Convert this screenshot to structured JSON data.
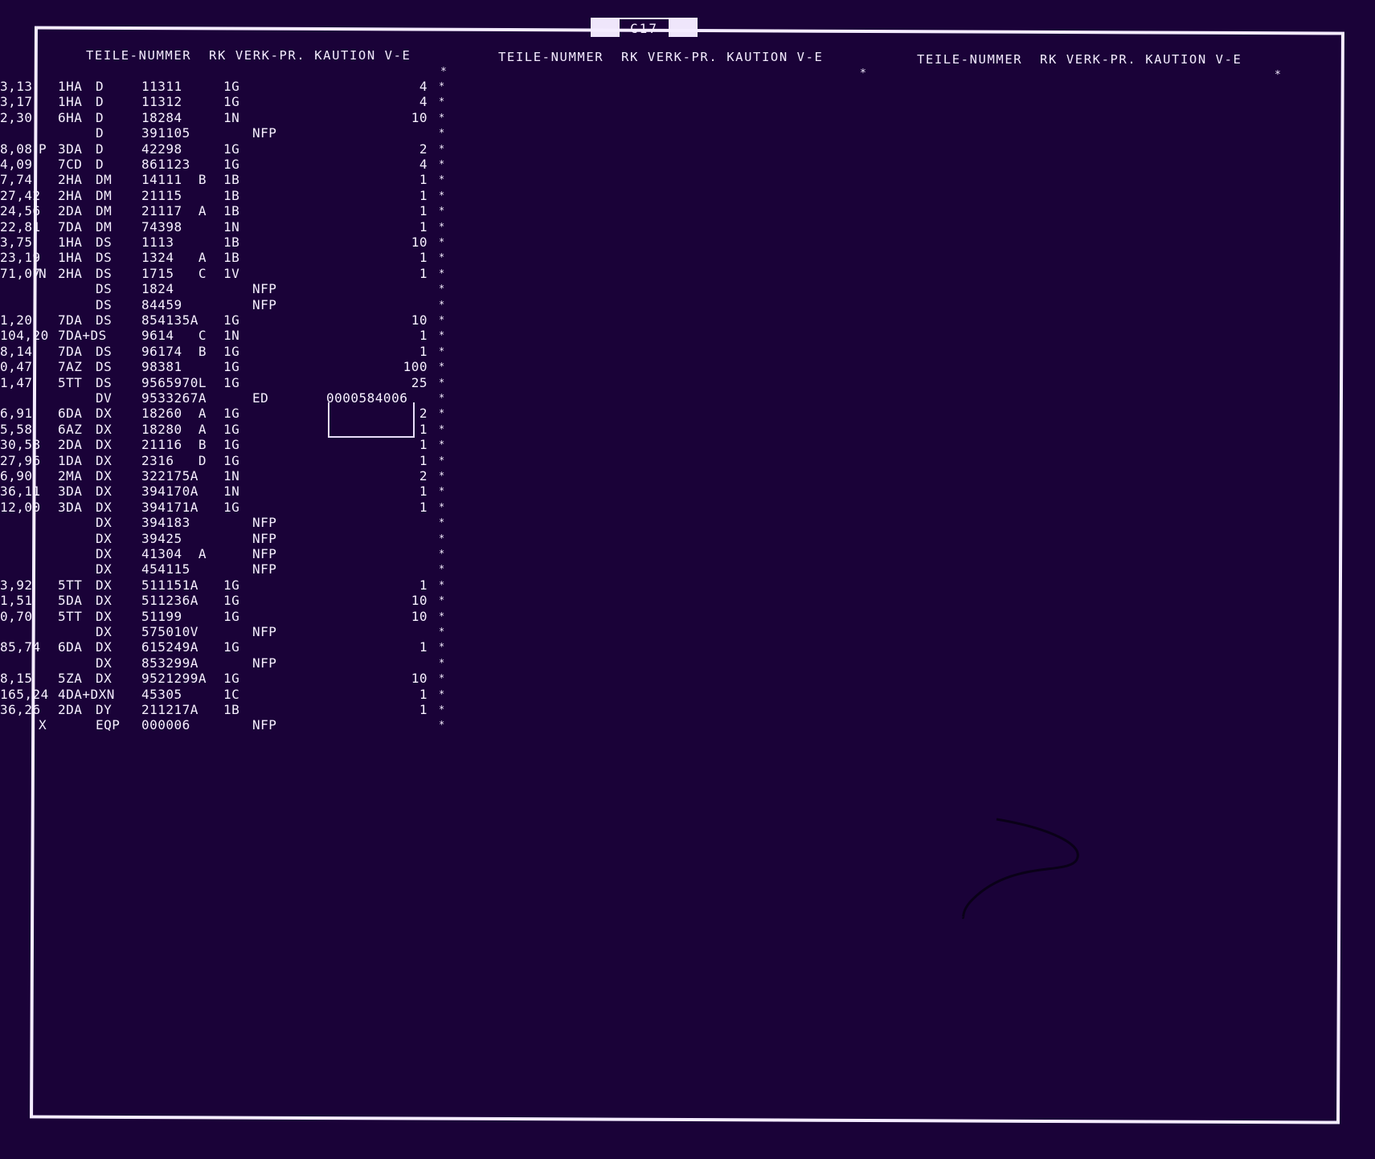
{
  "tab_label": "C17",
  "headers": [
    "TEILE-NUMMER  RK VERK-PR. KAUTION V-E",
    "TEILE-NUMMER  RK VERK-PR. KAUTION V-E",
    "TEILE-NUMMER  RK VERK-PR. KAUTION V-E"
  ],
  "header_stars": [
    "*",
    "*",
    "*"
  ],
  "rows": [
    {
      "flag": "",
      "loc": "1HA",
      "grp": "D",
      "num": "11311",
      "rk": "1G",
      "price": "3,13",
      "kaution": "",
      "ve": "4",
      "star": "*"
    },
    {
      "flag": "",
      "loc": "1HA",
      "grp": "D",
      "num": "11312",
      "rk": "1G",
      "price": "3,17",
      "kaution": "",
      "ve": "4",
      "star": "*"
    },
    {
      "flag": "",
      "loc": "6HA",
      "grp": "D",
      "num": "18284",
      "rk": "1N",
      "price": "2,30",
      "kaution": "",
      "ve": "10",
      "star": "*"
    },
    {
      "flag": "",
      "loc": "",
      "grp": "D",
      "num": "391105",
      "rk": "",
      "price": "NFP",
      "kaution": "",
      "ve": "",
      "star": "*"
    },
    {
      "flag": "P",
      "loc": "3DA",
      "grp": "D",
      "num": "42298",
      "rk": "1G",
      "price": "8,08",
      "kaution": "",
      "ve": "2",
      "star": "*"
    },
    {
      "flag": "",
      "loc": "7CD",
      "grp": "D",
      "num": "861123",
      "rk": "1G",
      "price": "4,09",
      "kaution": "",
      "ve": "4",
      "star": "*"
    },
    {
      "flag": "",
      "loc": "2HA",
      "grp": "DM",
      "num": "14111  B",
      "rk": "1B",
      "price": "7,74",
      "kaution": "",
      "ve": "1",
      "star": "*"
    },
    {
      "flag": "",
      "loc": "2HA",
      "grp": "DM",
      "num": "21115",
      "rk": "1B",
      "price": "27,42",
      "kaution": "",
      "ve": "1",
      "star": "*"
    },
    {
      "flag": "",
      "loc": "2DA",
      "grp": "DM",
      "num": "21117  A",
      "rk": "1B",
      "price": "24,56",
      "kaution": "",
      "ve": "1",
      "star": "*"
    },
    {
      "flag": "",
      "loc": "7DA",
      "grp": "DM",
      "num": "74398",
      "rk": "1N",
      "price": "22,81",
      "kaution": "",
      "ve": "1",
      "star": "*"
    },
    {
      "flag": "",
      "loc": "1HA",
      "grp": "DS",
      "num": "1113",
      "rk": "1B",
      "price": "3,75",
      "kaution": "",
      "ve": "10",
      "star": "*"
    },
    {
      "flag": "",
      "loc": "1HA",
      "grp": "DS",
      "num": "1324   A",
      "rk": "1B",
      "price": "23,19",
      "kaution": "",
      "ve": "1",
      "star": "*"
    },
    {
      "flag": "N",
      "loc": "2HA",
      "grp": "DS",
      "num": "1715   C",
      "rk": "1V",
      "price": "71,07",
      "kaution": "",
      "ve": "1",
      "star": "*"
    },
    {
      "flag": "",
      "loc": "",
      "grp": "DS",
      "num": "1824",
      "rk": "",
      "price": "NFP",
      "kaution": "",
      "ve": "",
      "star": "*"
    },
    {
      "flag": "",
      "loc": "",
      "grp": "DS",
      "num": "84459",
      "rk": "",
      "price": "NFP",
      "kaution": "",
      "ve": "",
      "star": "*"
    },
    {
      "flag": "",
      "loc": "7DA",
      "grp": "DS",
      "num": "854135A",
      "rk": "1G",
      "price": "1,20",
      "kaution": "",
      "ve": "10",
      "star": "*"
    },
    {
      "flag": "",
      "loc": "7DA+DS",
      "grp": "",
      "num": "9614   C",
      "rk": "1N",
      "price": "104,20",
      "kaution": "",
      "ve": "1",
      "star": "*"
    },
    {
      "flag": "",
      "loc": "7DA",
      "grp": "DS",
      "num": "96174  B",
      "rk": "1G",
      "price": "8,14",
      "kaution": "",
      "ve": "1",
      "star": "*"
    },
    {
      "flag": "",
      "loc": "7AZ",
      "grp": "DS",
      "num": "98381",
      "rk": "1G",
      "price": "0,47",
      "kaution": "",
      "ve": "100",
      "star": "*"
    },
    {
      "flag": "",
      "loc": "5TT",
      "grp": "DS",
      "num": "9565970L",
      "rk": "1G",
      "price": "1,47",
      "kaution": "",
      "ve": "25",
      "star": "*"
    },
    {
      "flag": "",
      "loc": "",
      "grp": "DV",
      "num": "9533267A",
      "rk": "",
      "price": "ED",
      "kaution": "0000584006",
      "ve": "",
      "star": "*"
    },
    {
      "flag": "",
      "loc": "6DA",
      "grp": "DX",
      "num": "18260  A",
      "rk": "1G",
      "price": "6,91",
      "kaution": "",
      "ve": "2",
      "star": "*"
    },
    {
      "flag": "",
      "loc": "6AZ",
      "grp": "DX",
      "num": "18280  A",
      "rk": "1G",
      "price": "5,58",
      "kaution": "",
      "ve": "1",
      "star": "*"
    },
    {
      "flag": "",
      "loc": "2DA",
      "grp": "DX",
      "num": "21116  B",
      "rk": "1G",
      "price": "30,58",
      "kaution": "",
      "ve": "1",
      "star": "*"
    },
    {
      "flag": "",
      "loc": "1DA",
      "grp": "DX",
      "num": "2316   D",
      "rk": "1G",
      "price": "27,96",
      "kaution": "",
      "ve": "1",
      "star": "*"
    },
    {
      "flag": "",
      "loc": "2MA",
      "grp": "DX",
      "num": "322175A",
      "rk": "1N",
      "price": "6,90",
      "kaution": "",
      "ve": "2",
      "star": "*"
    },
    {
      "flag": "",
      "loc": "3DA",
      "grp": "DX",
      "num": "394170A",
      "rk": "1N",
      "price": "36,11",
      "kaution": "",
      "ve": "1",
      "star": "*"
    },
    {
      "flag": "",
      "loc": "3DA",
      "grp": "DX",
      "num": "394171A",
      "rk": "1G",
      "price": "12,00",
      "kaution": "",
      "ve": "1",
      "star": "*"
    },
    {
      "flag": "",
      "loc": "",
      "grp": "DX",
      "num": "394183",
      "rk": "",
      "price": "NFP",
      "kaution": "",
      "ve": "",
      "star": "*"
    },
    {
      "flag": "",
      "loc": "",
      "grp": "DX",
      "num": "39425",
      "rk": "",
      "price": "NFP",
      "kaution": "",
      "ve": "",
      "star": "*"
    },
    {
      "flag": "",
      "loc": "",
      "grp": "DX",
      "num": "41304  A",
      "rk": "",
      "price": "NFP",
      "kaution": "",
      "ve": "",
      "star": "*"
    },
    {
      "flag": "",
      "loc": "",
      "grp": "DX",
      "num": "454115",
      "rk": "",
      "price": "NFP",
      "kaution": "",
      "ve": "",
      "star": "*"
    },
    {
      "flag": "",
      "loc": "5TT",
      "grp": "DX",
      "num": "511151A",
      "rk": "1G",
      "price": "3,92",
      "kaution": "",
      "ve": "1",
      "star": "*"
    },
    {
      "flag": "",
      "loc": "5DA",
      "grp": "DX",
      "num": "511236A",
      "rk": "1G",
      "price": "1,51",
      "kaution": "",
      "ve": "10",
      "star": "*"
    },
    {
      "flag": "",
      "loc": "5TT",
      "grp": "DX",
      "num": "51199",
      "rk": "1G",
      "price": "0,70",
      "kaution": "",
      "ve": "10",
      "star": "*"
    },
    {
      "flag": "",
      "loc": "",
      "grp": "DX",
      "num": "575010V",
      "rk": "",
      "price": "NFP",
      "kaution": "",
      "ve": "",
      "star": "*"
    },
    {
      "flag": "",
      "loc": "6DA",
      "grp": "DX",
      "num": "615249A",
      "rk": "1G",
      "price": "85,74",
      "kaution": "",
      "ve": "1",
      "star": "*"
    },
    {
      "flag": "",
      "loc": "",
      "grp": "DX",
      "num": "853299A",
      "rk": "",
      "price": "NFP",
      "kaution": "",
      "ve": "",
      "star": "*"
    },
    {
      "flag": "",
      "loc": "5ZA",
      "grp": "DX",
      "num": "9521299A",
      "rk": "1G",
      "price": "8,15",
      "kaution": "",
      "ve": "10",
      "star": "*"
    },
    {
      "flag": "",
      "loc": "4DA+DXN",
      "grp": "",
      "num": "45305",
      "rk": "1C",
      "price": "165,24",
      "kaution": "",
      "ve": "1",
      "star": "*"
    },
    {
      "flag": "",
      "loc": "2DA",
      "grp": "DY",
      "num": "211217A",
      "rk": "1B",
      "price": "36,26",
      "kaution": "",
      "ve": "1",
      "star": "*"
    },
    {
      "flag": "X",
      "loc": "",
      "grp": "EQP",
      "num": "000006",
      "rk": "",
      "price": "NFP",
      "kaution": "",
      "ve": "",
      "star": "*"
    }
  ],
  "colors": {
    "background": "#1a0238",
    "text": "#f4ecff"
  }
}
